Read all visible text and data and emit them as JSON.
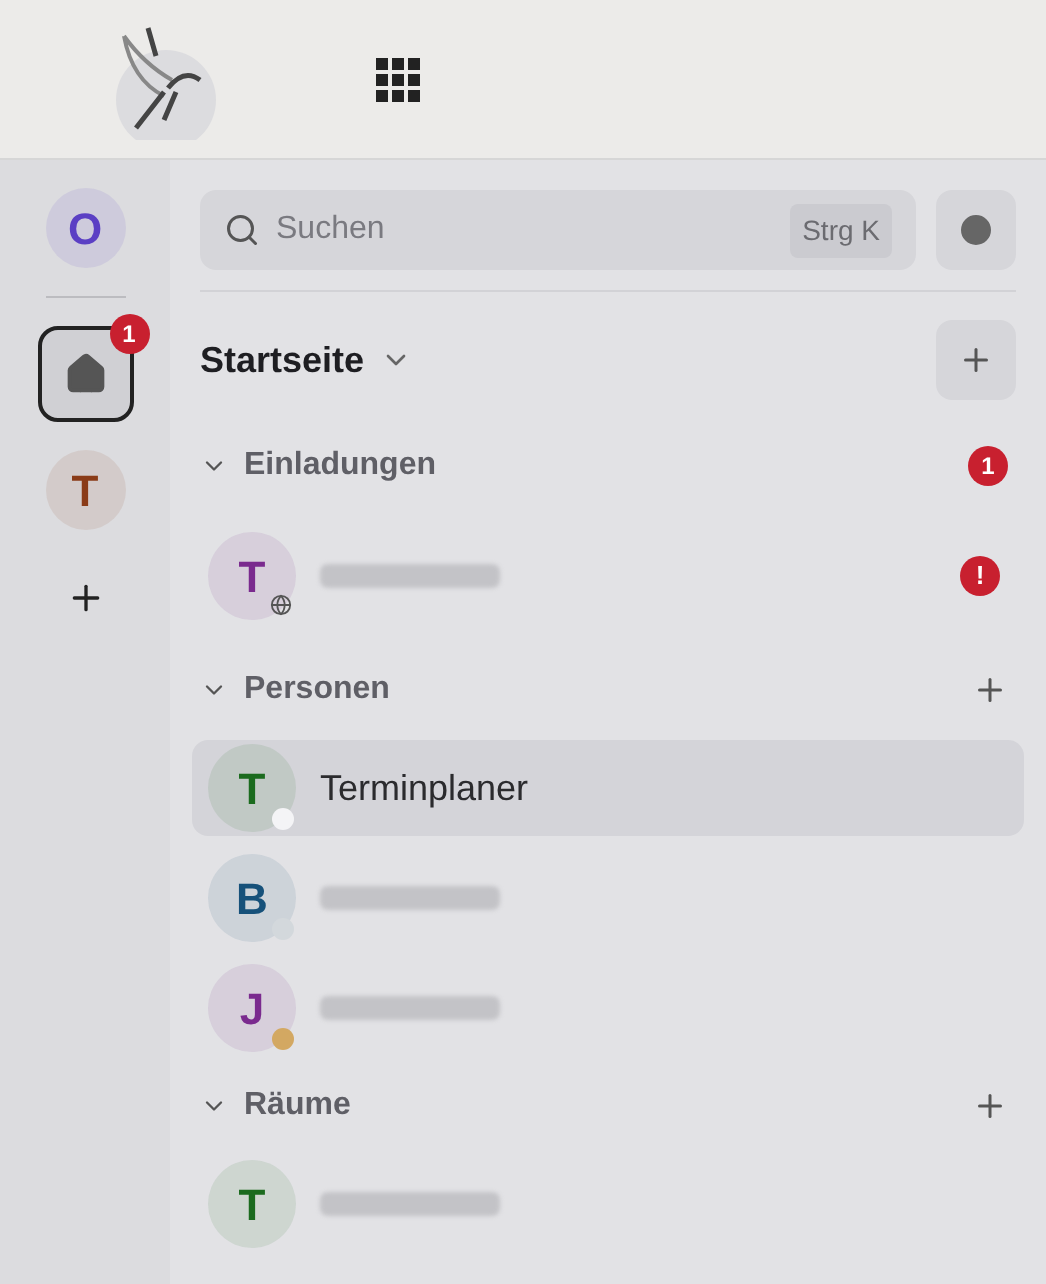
{
  "rail": {
    "items": [
      {
        "kind": "avatar",
        "letter": "O",
        "color": "#5b3fc4",
        "selected": false
      },
      {
        "kind": "home",
        "badge": "1",
        "selected": true
      },
      {
        "kind": "avatar",
        "letter": "T",
        "color": "#8a3b17",
        "selected": false
      },
      {
        "kind": "add",
        "selected": false
      }
    ]
  },
  "search": {
    "placeholder": "Suchen",
    "shortcut": "Strg K"
  },
  "home_title": "Startseite",
  "sections": [
    {
      "title": "Einladungen",
      "expanded": true,
      "kind": "badge",
      "badge": "1",
      "items": [
        {
          "kind": "blurred",
          "letter": "T",
          "color": "#7a2a8e",
          "public": true,
          "alert": "!",
          "selected": false
        }
      ]
    },
    {
      "title": "Personen",
      "expanded": true,
      "kind": "add",
      "items": [
        {
          "kind": "named",
          "letter": "T",
          "color": "#1b6b1e",
          "title": "Terminplaner",
          "presence": {
            "color": "#f4f4f6"
          },
          "selected": true
        },
        {
          "kind": "blurred",
          "letter": "B",
          "color": "#16517a",
          "presence": {
            "color": "#d3d8dc"
          },
          "selected": false
        },
        {
          "kind": "blurred",
          "letter": "J",
          "color": "#7a2a8e",
          "presence": {
            "color": "#d3a862"
          },
          "selected": false
        }
      ]
    },
    {
      "title": "Räume",
      "expanded": true,
      "kind": "add",
      "items": [
        {
          "kind": "blurred",
          "letter": "T",
          "color": "#1b6b1e",
          "selected": false
        }
      ]
    }
  ]
}
